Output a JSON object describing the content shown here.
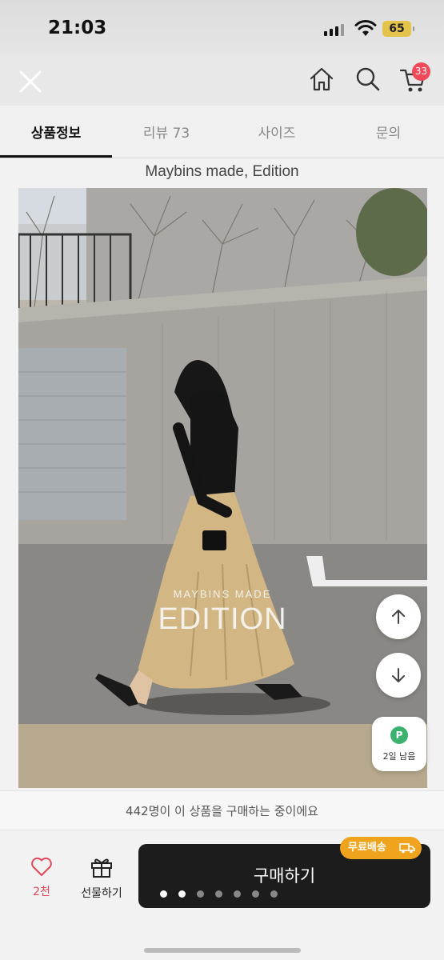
{
  "status_bar": {
    "time": "21:03",
    "battery": "65"
  },
  "top_nav": {
    "cart_count": "33"
  },
  "tabs": [
    {
      "label": "상품정보",
      "active": true
    },
    {
      "label": "리뷰 73",
      "active": false
    },
    {
      "label": "사이즈",
      "active": false
    },
    {
      "label": "문의",
      "active": false
    }
  ],
  "product": {
    "brand_title": "Maybins made, Edition",
    "image_overlay_sub": "MAYBINS MADE",
    "image_overlay_main": "EDITION"
  },
  "points": {
    "badge": "P",
    "label": "2일 남음"
  },
  "notice": "442명이 이 상품을 구매하는 중이에요",
  "bottom_bar": {
    "like_count": "2천",
    "gift_label": "선물하기",
    "buy_label": "구매하기",
    "free_shipping_label": "무료배송"
  },
  "carousel": {
    "total": 7,
    "active_indices": [
      0,
      1
    ]
  },
  "colors": {
    "accent": "#e24757",
    "free_shipping": "#f0a31c",
    "buy_button": "#1c1c1c",
    "points": "#3bb36e"
  },
  "icons": [
    "close-icon",
    "home-icon",
    "search-icon",
    "cart-icon",
    "heart-icon",
    "gift-icon",
    "arrow-up-icon",
    "arrow-down-icon",
    "truck-icon"
  ]
}
